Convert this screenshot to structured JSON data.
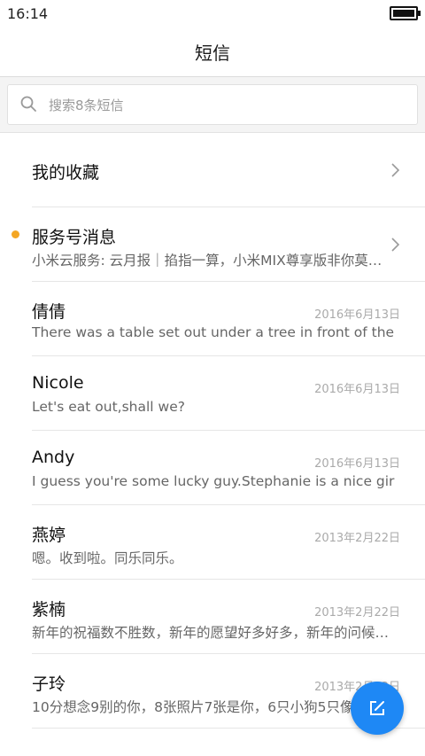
{
  "status": {
    "time": "16:14"
  },
  "header": {
    "title": "短信"
  },
  "search": {
    "placeholder": "搜索8条短信"
  },
  "colors": {
    "accent": "#1e88f5",
    "unread_dot": "#f4a623"
  },
  "favorites": {
    "label": "我的收藏"
  },
  "service": {
    "name": "服务号消息",
    "preview": "小米云服务: 云月报｜掐指一算，小米MIX尊享版非你莫…"
  },
  "conversations": [
    {
      "name": "倩倩",
      "date": "2016年6月13日",
      "preview": "There was a table set out under a tree in front of the ho.."
    },
    {
      "name": "Nicole",
      "date": "2016年6月13日",
      "preview": "Let's eat out,shall we?"
    },
    {
      "name": "Andy",
      "date": "2016年6月13日",
      "preview": "I guess you're some lucky guy.Stephanie is a nice girl."
    },
    {
      "name": "燕婷",
      "date": "2013年2月22日",
      "preview": "嗯。收到啦。同乐同乐。"
    },
    {
      "name": "紫楠",
      "date": "2013年2月22日",
      "preview": "新年的祝福数不胜数，新年的愿望好多好多，新年的问候…"
    },
    {
      "name": "子玲",
      "date": "2013年2月22日",
      "preview": "10分想念9别的你，8张照片7张是你，6只小狗5只像你…"
    }
  ],
  "icons": {
    "search": "search-icon",
    "chevron": "chevron-right-icon",
    "compose": "compose-icon",
    "battery": "battery-icon"
  }
}
